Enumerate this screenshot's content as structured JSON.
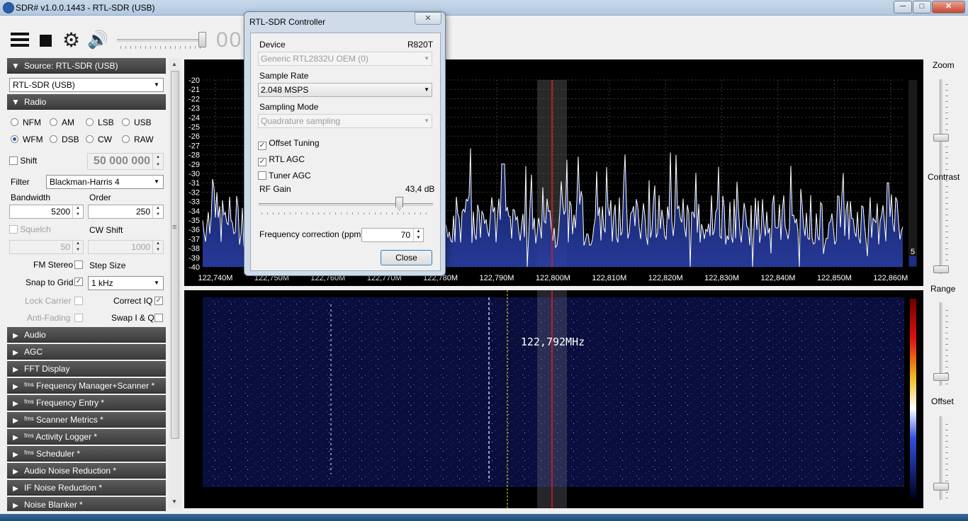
{
  "window": {
    "title": "SDR# v1.0.0.1443 - RTL-SDR (USB)",
    "min": "─",
    "max": "□",
    "close": "✕"
  },
  "toolbar": {
    "frequency_display": "00"
  },
  "source": {
    "header": "Source: RTL-SDR (USB)",
    "device": "RTL-SDR (USB)"
  },
  "radio": {
    "header": "Radio",
    "modes": [
      "NFM",
      "AM",
      "LSB",
      "USB",
      "WFM",
      "DSB",
      "CW",
      "RAW"
    ],
    "selected_mode": "WFM",
    "shift_label": "Shift",
    "shift_value": "50 000 000",
    "filter_label": "Filter",
    "filter_value": "Blackman-Harris 4",
    "bandwidth_label": "Bandwidth",
    "bandwidth_value": "5200",
    "order_label": "Order",
    "order_value": "250",
    "squelch_label": "Squelch",
    "squelch_value": "50",
    "cwshift_label": "CW Shift",
    "cwshift_value": "1000",
    "fmstereo_label": "FM Stereo",
    "stepsize_label": "Step Size",
    "snap_label": "Snap to Grid",
    "step_value": "1 kHz",
    "lockcarrier_label": "Lock Carrier",
    "correctiq_label": "Correct IQ",
    "antifading_label": "Anti-Fading",
    "swapiq_label": "Swap I & Q"
  },
  "sections": [
    "Audio",
    "AGC",
    "FFT Display",
    "ᶠᵐˢ Frequency Manager+Scanner *",
    "ᶠᵐˢ Frequency Entry *",
    "ᶠᵐˢ Scanner Metrics *",
    "ᶠᵐˢ Activity Logger *",
    "ᶠᵐˢ Scheduler *",
    "Audio Noise Reduction *",
    "IF Noise Reduction *",
    "Noise Blanker *"
  ],
  "right_controls": {
    "zoom": "Zoom",
    "contrast": "Contrast",
    "range": "Range",
    "offset": "Offset"
  },
  "spectrum": {
    "y_ticks": [
      "-20",
      "-21",
      "-22",
      "-23",
      "-24",
      "-25",
      "-26",
      "-27",
      "-28",
      "-29",
      "-30",
      "-31",
      "-32",
      "-33",
      "-34",
      "-35",
      "-36",
      "-37",
      "-38",
      "-39",
      "-40"
    ],
    "x_ticks": [
      "122,740M",
      "122,750M",
      "122,760M",
      "122,770M",
      "122,780M",
      "122,790M",
      "122,800M",
      "122,810M",
      "122,820M",
      "122,830M",
      "122,840M",
      "122,850M",
      "122,860M"
    ],
    "peak_label": "5",
    "trace_color": "#ffffff",
    "fill_color": "#1a2f8a",
    "center_line_color": "#d81e1e"
  },
  "waterfall": {
    "cursor_label": "122,792MHz",
    "cursor_color": "#e8d020"
  },
  "dialog": {
    "title": "RTL-SDR Controller",
    "close_x": "✕",
    "device_label": "Device",
    "tuner": "R820T",
    "device_value": "Generic RTL2832U OEM (0)",
    "samplerate_label": "Sample Rate",
    "samplerate_value": "2.048 MSPS",
    "samplingmode_label": "Sampling Mode",
    "samplingmode_value": "Quadrature sampling",
    "offset_tuning": "Offset Tuning",
    "rtl_agc": "RTL AGC",
    "tuner_agc": "Tuner AGC",
    "rfgain_label": "RF Gain",
    "rfgain_value": "43,4 dB",
    "freqcorr_label": "Frequency correction (ppm)",
    "freqcorr_value": "70",
    "close_button": "Close"
  }
}
